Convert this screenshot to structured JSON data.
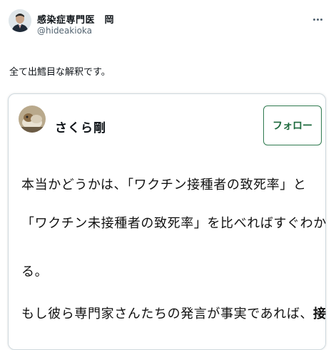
{
  "author": {
    "display_name": "感染症専門医　岡",
    "handle": "@hideakioka"
  },
  "tweet": {
    "text": "全て出鱈目な解釈です。"
  },
  "quoted": {
    "author_name": "さくら剛",
    "follow_label": "フォロー",
    "lines": [
      "本当かどうかは、「ワクチン接種者の致死率」と",
      "「ワクチン未接種者の致死率」を比べればすぐわか",
      "る。",
      "もし彼ら専門家さんたちの発言が事実であれば、"
    ],
    "line_4_bold": "接"
  },
  "colors": {
    "follow_border": "#2f7a4f",
    "handle_gray": "#536471",
    "card_border": "#cfd9de"
  }
}
